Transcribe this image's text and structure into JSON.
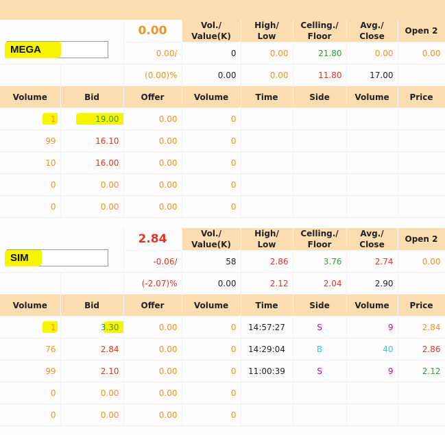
{
  "panels": [
    {
      "symbol": "MEGA",
      "price": "0.00",
      "change": "0.00/",
      "change_pct": "(0.00)%",
      "headers": {
        "vol_value": [
          "Vol./",
          "Value(K)"
        ],
        "high_low": [
          "High/",
          "Low"
        ],
        "ceiling_floor": [
          "Celling./",
          "Floor"
        ],
        "avg_close": [
          "Avg./",
          "Close"
        ],
        "open2": "Open 2"
      },
      "volume": "0",
      "value_k": "0.00",
      "high": "0.00",
      "low": "0.00",
      "ceiling": "21.80",
      "floor": "11.80",
      "avg": "0.00",
      "close": "17.00",
      "open2": "0.00",
      "book_headers": [
        "Volume",
        "Bid",
        "Offer",
        "Volume",
        "Time",
        "Side",
        "Volume",
        "Price"
      ],
      "book_rows": [
        {
          "bid_vol": "1",
          "bid": "19.00",
          "offer": "0.00",
          "offer_vol": "0",
          "time": "",
          "side": "",
          "deal_vol": "",
          "deal_price": ""
        },
        {
          "bid_vol": "99",
          "bid": "16.10",
          "offer": "0.00",
          "offer_vol": "0",
          "time": "",
          "side": "",
          "deal_vol": "",
          "deal_price": ""
        },
        {
          "bid_vol": "10",
          "bid": "16.00",
          "offer": "0.00",
          "offer_vol": "0",
          "time": "",
          "side": "",
          "deal_vol": "",
          "deal_price": ""
        },
        {
          "bid_vol": "0",
          "bid": "0.00",
          "offer": "0.00",
          "offer_vol": "0",
          "time": "",
          "side": "",
          "deal_vol": "",
          "deal_price": ""
        },
        {
          "bid_vol": "0",
          "bid": "0.00",
          "offer": "0.00",
          "offer_vol": "0",
          "time": "",
          "side": "",
          "deal_vol": "",
          "deal_price": ""
        }
      ]
    },
    {
      "symbol": "SIM",
      "price": "2.84",
      "change": "-0.06/",
      "change_pct": "(-2.07)%",
      "headers": {
        "vol_value": [
          "Vol./",
          "Value(K)"
        ],
        "high_low": [
          "High/",
          "Low"
        ],
        "ceiling_floor": [
          "Celling./",
          "Floor"
        ],
        "avg_close": [
          "Avg./",
          "Close"
        ],
        "open2": "Open 2"
      },
      "volume": "58",
      "value_k": "0.00",
      "high": "2.86",
      "low": "2.12",
      "ceiling": "3.76",
      "floor": "2.04",
      "avg": "2.74",
      "close": "2.90",
      "open2": "0.00",
      "book_headers": [
        "Volume",
        "Bid",
        "Offer",
        "Volume",
        "Time",
        "Side",
        "Volume",
        "Price"
      ],
      "book_rows": [
        {
          "bid_vol": "1",
          "bid": "3.30",
          "offer": "0.00",
          "offer_vol": "0",
          "time": "14:57:27",
          "side": "S",
          "deal_vol": "9",
          "deal_price": "2.84"
        },
        {
          "bid_vol": "76",
          "bid": "2.84",
          "offer": "0.00",
          "offer_vol": "0",
          "time": "14:29:04",
          "side": "B",
          "deal_vol": "40",
          "deal_price": "2.86"
        },
        {
          "bid_vol": "99",
          "bid": "2.10",
          "offer": "0.00",
          "offer_vol": "0",
          "time": "11:00:39",
          "side": "S",
          "deal_vol": "9",
          "deal_price": "2.12"
        },
        {
          "bid_vol": "0",
          "bid": "0.00",
          "offer": "0.00",
          "offer_vol": "0",
          "time": "",
          "side": "",
          "deal_vol": "",
          "deal_price": ""
        },
        {
          "bid_vol": "0",
          "bid": "0.00",
          "offer": "0.00",
          "offer_vol": "0",
          "time": "",
          "side": "",
          "deal_vol": "",
          "deal_price": ""
        }
      ]
    }
  ],
  "colors": {
    "header_bg": "#fcdcb1",
    "highlight": "#f7f400",
    "unchanged": "#f6921e",
    "down": "#e63322",
    "up": "#3a9a3a",
    "sell": "#e000a0",
    "buy": "#1fd0e8"
  }
}
